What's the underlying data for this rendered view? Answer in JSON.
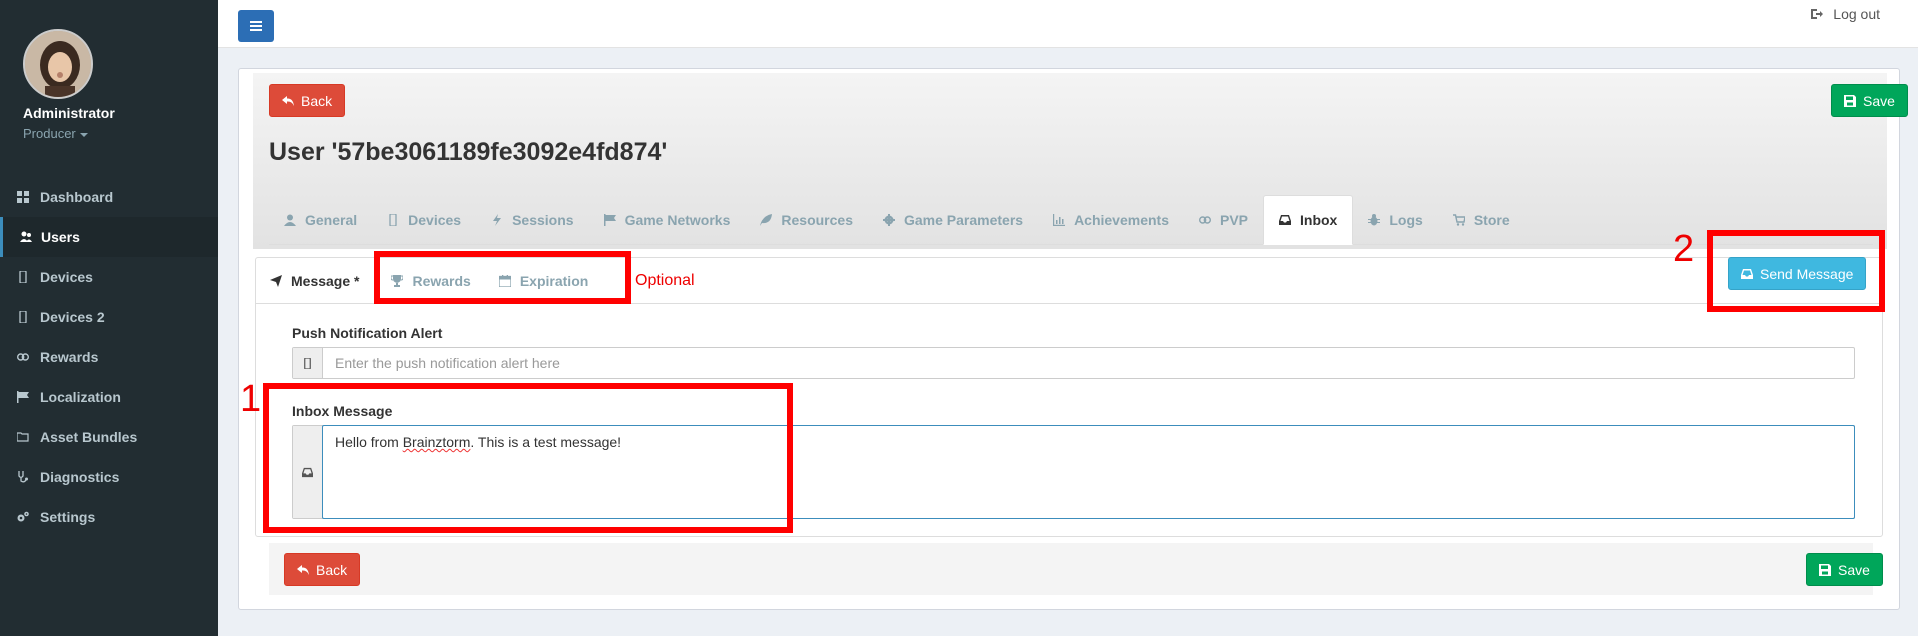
{
  "sidebar": {
    "user_name": "Administrator",
    "user_role": "Producer",
    "items": [
      {
        "label": "Dashboard",
        "icon": "dashboard-icon"
      },
      {
        "label": "Users",
        "icon": "users-icon",
        "active": true
      },
      {
        "label": "Devices",
        "icon": "mobile-icon"
      },
      {
        "label": "Devices 2",
        "icon": "mobile-icon"
      },
      {
        "label": "Rewards",
        "icon": "link-icon"
      },
      {
        "label": "Localization",
        "icon": "flag-icon"
      },
      {
        "label": "Asset Bundles",
        "icon": "folder-icon"
      },
      {
        "label": "Diagnostics",
        "icon": "stethoscope-icon"
      },
      {
        "label": "Settings",
        "icon": "cogs-icon"
      }
    ]
  },
  "header": {
    "logout_label": "Log out"
  },
  "page": {
    "back_label": "Back",
    "save_label": "Save",
    "title": "User '57be3061189fe3092e4fd874'",
    "send_message_label": "Send Message"
  },
  "tabs": [
    {
      "label": "General",
      "icon": "user-icon"
    },
    {
      "label": "Devices",
      "icon": "mobile-icon"
    },
    {
      "label": "Sessions",
      "icon": "bolt-icon"
    },
    {
      "label": "Game Networks",
      "icon": "flag-icon"
    },
    {
      "label": "Resources",
      "icon": "leaf-icon"
    },
    {
      "label": "Game Parameters",
      "icon": "cog-icon"
    },
    {
      "label": "Achievements",
      "icon": "bar-chart-icon"
    },
    {
      "label": "PVP",
      "icon": "link-icon"
    },
    {
      "label": "Inbox",
      "icon": "inbox-icon",
      "active": true
    },
    {
      "label": "Logs",
      "icon": "bug-icon"
    },
    {
      "label": "Store",
      "icon": "cart-icon"
    }
  ],
  "subtabs": [
    {
      "label": "Message *",
      "icon": "paper-plane-icon",
      "active": true
    },
    {
      "label": "Rewards",
      "icon": "trophy-icon"
    },
    {
      "label": "Expiration",
      "icon": "calendar-icon"
    }
  ],
  "optional_label": "Optional",
  "form": {
    "push_label": "Push Notification Alert",
    "push_placeholder": "Enter the push notification alert here",
    "inbox_label": "Inbox Message",
    "inbox_value_pre": "Hello from ",
    "inbox_value_word": "Brainztorm",
    "inbox_value_post": ". This is a test message!"
  },
  "annotations": {
    "one": "1",
    "two": "2"
  }
}
